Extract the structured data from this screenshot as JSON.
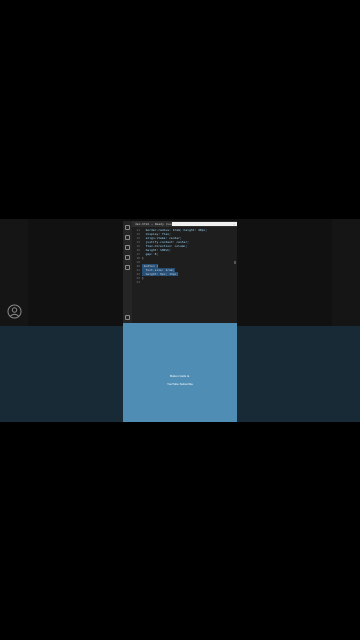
{
  "editor": {
    "tab_title": "dex.html — Ready (Lucid), demo.scss",
    "tab_actions": "⋯",
    "lines": [
      {
        "num": "11",
        "text": "  border-radius: 4rem; height: 40px;"
      },
      {
        "num": "12",
        "text": "  display: flex;"
      },
      {
        "num": "13",
        "text": "  align-items: center;"
      },
      {
        "num": "14",
        "text": "  justify-content: center;"
      },
      {
        "num": "15",
        "text": "  flex-direction: column;"
      },
      {
        "num": "16",
        "text": "  height: 100vh;"
      },
      {
        "num": "17",
        "text": "  gap: 8;"
      },
      {
        "num": "18",
        "text": "}"
      },
      {
        "num": "19",
        "text": ""
      },
      {
        "num": "20",
        "text": ".button {"
      },
      {
        "num": "21",
        "text": "  font-size: 1rem;"
      },
      {
        "num": "22",
        "text": "  height: 9px; 13px;"
      },
      {
        "num": "23",
        "text": "}"
      },
      {
        "num": "24",
        "text": ""
      }
    ]
  },
  "preview": {
    "line1": "Button Cells ►",
    "line2": "YouTube Subscribe"
  },
  "colors": {
    "editor_bg": "#1e1e1e",
    "preview_bg": "#4f8db5",
    "bottom_band": "#172a35"
  },
  "icons": [
    "avatar-icon",
    "files-icon",
    "search-icon",
    "source-control-icon",
    "debug-icon",
    "extensions-icon",
    "settings-icon"
  ]
}
